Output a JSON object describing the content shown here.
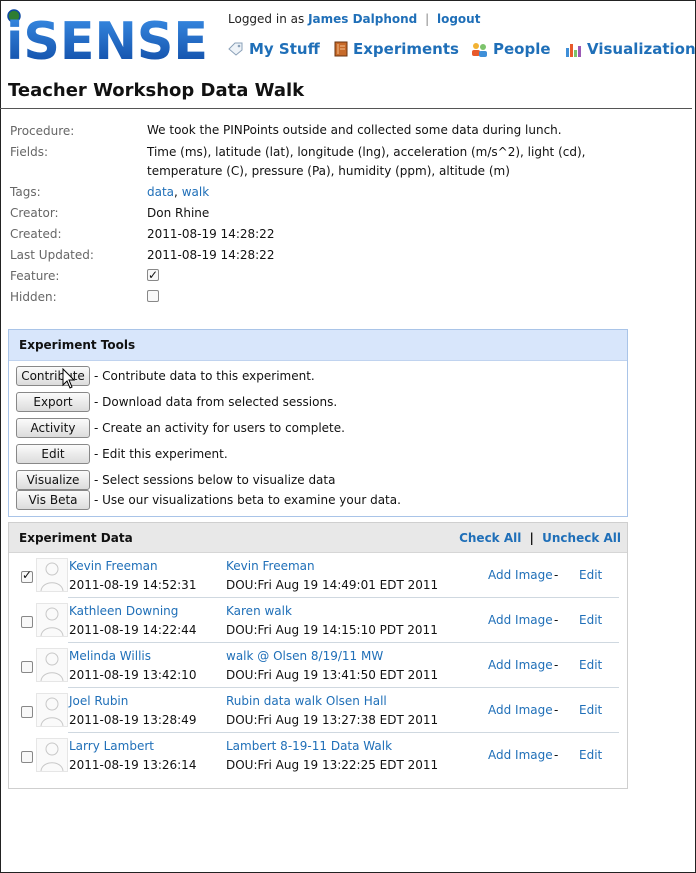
{
  "header": {
    "logo_text": "iSENSE",
    "logged_in_prefix": "Logged in as",
    "user_name": "James Dalphond",
    "separator": "|",
    "logout_label": "logout",
    "nav": [
      {
        "label": "My Stuff",
        "icon": "tag-icon"
      },
      {
        "label": "Experiments",
        "icon": "notebook-icon"
      },
      {
        "label": "People",
        "icon": "people-icon"
      },
      {
        "label": "Visualizations",
        "icon": "bar-chart-icon"
      }
    ]
  },
  "page_title": "Teacher Workshop Data Walk",
  "details": {
    "procedure_label": "Procedure:",
    "procedure_value": "We took the PINPoints outside and collected some data during lunch.",
    "fields_label": "Fields:",
    "fields_value": "Time (ms), latitude (lat), longitude (lng), acceleration (m/s^2), light (cd), temperature (C), pressure (Pa), humidity (ppm), altitude (m)",
    "tags_label": "Tags:",
    "tags": [
      "data",
      "walk"
    ],
    "tags_sep": ",",
    "creator_label": "Creator:",
    "creator_value": "Don Rhine",
    "created_label": "Created:",
    "created_value": "2011-08-19 14:28:22",
    "updated_label": "Last Updated:",
    "updated_value": "2011-08-19 14:28:22",
    "feature_label": "Feature:",
    "feature_checked": true,
    "hidden_label": "Hidden:",
    "hidden_checked": false
  },
  "tools": {
    "title": "Experiment Tools",
    "items": [
      {
        "button": "Contribute",
        "desc": "- Contribute data to this experiment."
      },
      {
        "button": "Export",
        "desc": "- Download data from selected sessions."
      },
      {
        "button": "Activity",
        "desc": "- Create an activity for users to complete."
      },
      {
        "button": "Edit",
        "desc": "- Edit this experiment."
      },
      {
        "button": "Visualize",
        "desc": "- Select sessions below to visualize data"
      },
      {
        "button": "Vis Beta",
        "desc": "- Use our visualizations beta to examine your data."
      }
    ]
  },
  "data": {
    "title": "Experiment Data",
    "check_all": "Check All",
    "sep": "|",
    "uncheck_all": "Uncheck All",
    "add_image_label": "Add Image",
    "dash": "-",
    "edit_label": "Edit",
    "rows": [
      {
        "checked": true,
        "name": "Kevin Freeman",
        "date": "2011-08-19 14:52:31",
        "session": "Kevin Freeman",
        "dou": "DOU:Fri Aug 19 14:49:01 EDT 2011"
      },
      {
        "checked": false,
        "name": "Kathleen Downing",
        "date": "2011-08-19 14:22:44",
        "session": "Karen walk",
        "dou": "DOU:Fri Aug 19 14:15:10 PDT 2011"
      },
      {
        "checked": false,
        "name": "Melinda Willis",
        "date": "2011-08-19 13:42:10",
        "session": "walk @ Olsen 8/19/11 MW",
        "dou": "DOU:Fri Aug 19 13:41:50 EDT 2011"
      },
      {
        "checked": false,
        "name": "Joel Rubin",
        "date": "2011-08-19 13:28:49",
        "session": "Rubin data walk Olsen Hall",
        "dou": "DOU:Fri Aug 19 13:27:38 EDT 2011"
      },
      {
        "checked": false,
        "name": "Larry Lambert",
        "date": "2011-08-19 13:26:14",
        "session": "Lambert 8-19-11 Data Walk",
        "dou": "DOU:Fri Aug 19 13:22:25 EDT 2011"
      }
    ]
  },
  "colors": {
    "link": "#1f6fb8",
    "logo": "#1565c0",
    "tools_header": "#d8e6fb",
    "data_header": "#e8e8e8"
  }
}
